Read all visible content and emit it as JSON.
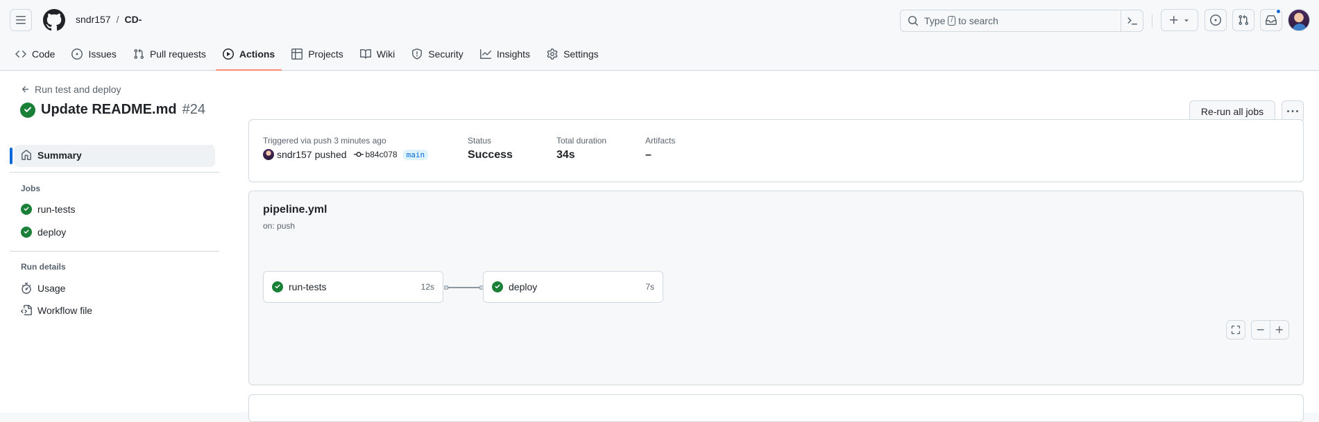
{
  "header": {
    "owner": "sndr157",
    "separator": "/",
    "repo": "CD-",
    "search": {
      "prefix": "Type",
      "key": "/",
      "suffix": "to search"
    }
  },
  "tabs": [
    {
      "label": "Code",
      "icon": "code-icon"
    },
    {
      "label": "Issues",
      "icon": "issue-opened-icon"
    },
    {
      "label": "Pull requests",
      "icon": "git-pull-request-icon"
    },
    {
      "label": "Actions",
      "icon": "play-icon",
      "active": true
    },
    {
      "label": "Projects",
      "icon": "table-icon"
    },
    {
      "label": "Wiki",
      "icon": "book-icon"
    },
    {
      "label": "Security",
      "icon": "shield-icon"
    },
    {
      "label": "Insights",
      "icon": "graph-icon"
    },
    {
      "label": "Settings",
      "icon": "gear-icon"
    }
  ],
  "run": {
    "back_label": "Run test and deploy",
    "title": "Update README.md",
    "number": "#24",
    "rerun_label": "Re-run all jobs"
  },
  "sidebar": {
    "summary_label": "Summary",
    "jobs_heading": "Jobs",
    "jobs": [
      {
        "label": "run-tests"
      },
      {
        "label": "deploy"
      }
    ],
    "run_details_heading": "Run details",
    "details": [
      {
        "label": "Usage"
      },
      {
        "label": "Workflow file"
      }
    ]
  },
  "summary": {
    "trigger_label": "Triggered via push 3 minutes ago",
    "actor": "sndr157",
    "action": "pushed",
    "sha": "b84c078",
    "branch": "main",
    "status_label": "Status",
    "status_value": "Success",
    "duration_label": "Total duration",
    "duration_value": "34s",
    "artifacts_label": "Artifacts",
    "artifacts_value": "–"
  },
  "workflow": {
    "file": "pipeline.yml",
    "trigger": "on: push",
    "jobs": [
      {
        "name": "run-tests",
        "duration": "12s"
      },
      {
        "name": "deploy",
        "duration": "7s"
      }
    ]
  },
  "colors": {
    "success": "#1a7f37",
    "accent": "#0969da",
    "active_tab_underline": "#fd8c73"
  }
}
